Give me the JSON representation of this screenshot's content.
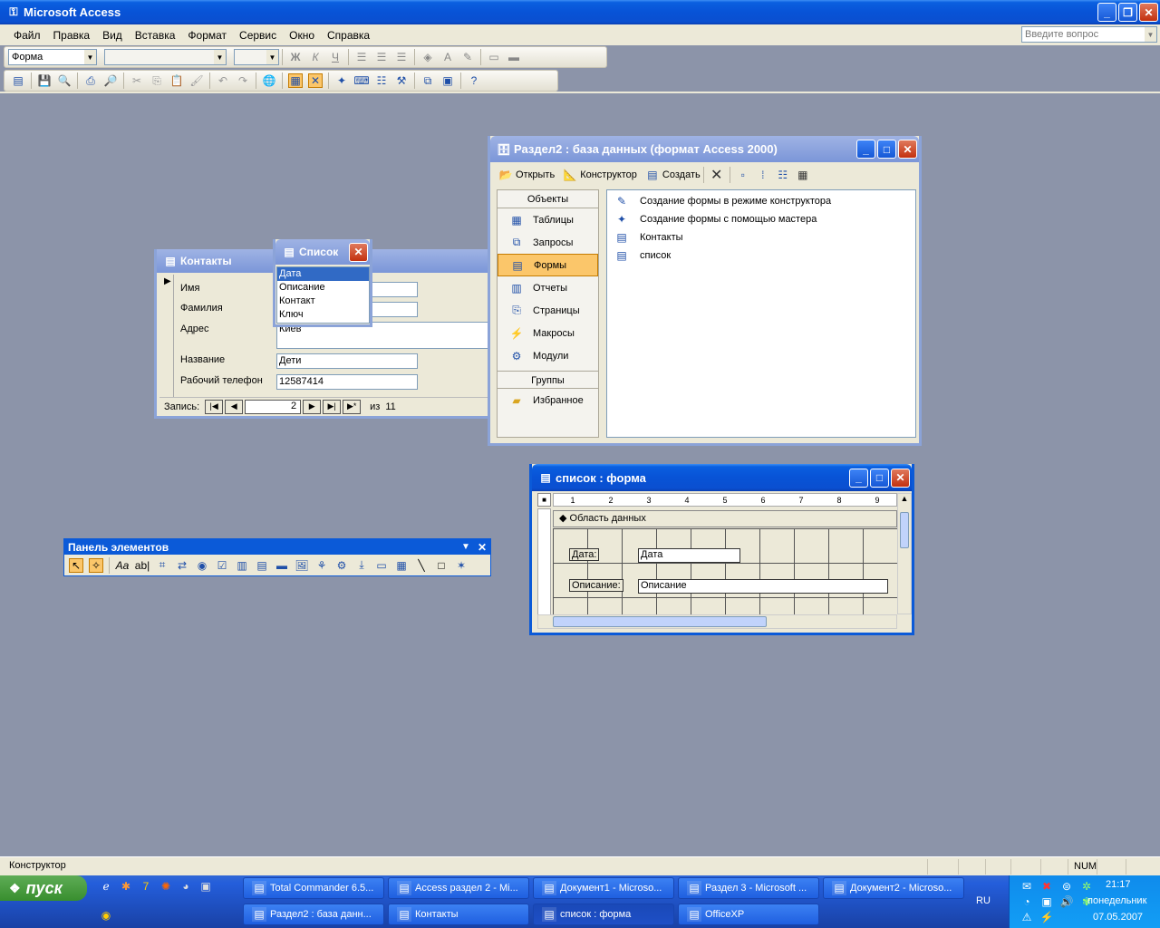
{
  "app": {
    "title": "Microsoft Access"
  },
  "menu": {
    "items": [
      "Файл",
      "Правка",
      "Вид",
      "Вставка",
      "Формат",
      "Сервис",
      "Окно",
      "Справка"
    ],
    "help_placeholder": "Введите вопрос"
  },
  "format_toolbar": {
    "object_value": "Форма"
  },
  "contacts_form": {
    "title": "Контакты",
    "fields": [
      {
        "label": "Имя",
        "value": ""
      },
      {
        "label": "Фамилия",
        "value": ""
      },
      {
        "label": "Адрес",
        "value": "Киев"
      },
      {
        "label": "Название",
        "value": "Дети"
      },
      {
        "label": "Рабочий телефон",
        "value": "12587414"
      }
    ],
    "nav": {
      "label": "Запись:",
      "current": "2",
      "of_label": "из",
      "total": "11"
    }
  },
  "list_popup": {
    "title": "Список",
    "items": [
      "Дата",
      "Описание",
      "Контакт",
      "Ключ"
    ],
    "selected": 0
  },
  "db_window": {
    "title": "Раздел2 : база данных (формат Access 2000)",
    "toolbar": {
      "open": "Открыть",
      "design": "Конструктор",
      "create": "Создать"
    },
    "objects_header": "Объекты",
    "objects": [
      {
        "label": "Таблицы",
        "icon": "table-icon"
      },
      {
        "label": "Запросы",
        "icon": "query-icon"
      },
      {
        "label": "Формы",
        "icon": "form-icon",
        "selected": true
      },
      {
        "label": "Отчеты",
        "icon": "report-icon"
      },
      {
        "label": "Страницы",
        "icon": "page-icon"
      },
      {
        "label": "Макросы",
        "icon": "macro-icon"
      },
      {
        "label": "Модули",
        "icon": "module-icon"
      }
    ],
    "groups_header": "Группы",
    "groups": [
      {
        "label": "Избранное",
        "icon": "folder-icon"
      }
    ],
    "list": [
      {
        "label": "Создание формы в режиме конструктора",
        "icon": "design-wizard-icon"
      },
      {
        "label": "Создание формы с помощью мастера",
        "icon": "wizard-icon"
      },
      {
        "label": "Контакты",
        "icon": "form-icon"
      },
      {
        "label": "список",
        "icon": "form-icon"
      }
    ]
  },
  "design_window": {
    "title": "список : форма",
    "section": "Область данных",
    "ruler": [
      "1",
      "2",
      "3",
      "4",
      "5",
      "6",
      "7",
      "8",
      "9"
    ],
    "controls": [
      {
        "label": "Дата:",
        "field": "Дата"
      },
      {
        "label": "Описание:",
        "field": "Описание"
      }
    ]
  },
  "toolbox": {
    "title": "Панель элементов"
  },
  "status": {
    "text": "Конструктор",
    "num": "NUM"
  },
  "taskbar": {
    "start": "пуск",
    "row1": [
      "Total Commander 6.5...",
      "Access раздел 2 - Mi...",
      "Документ1 - Microso...",
      "Раздел 3 - Microsoft ...",
      "Документ2 - Microso..."
    ],
    "row2": [
      "Раздел2 : база данн...",
      "Контакты",
      "список : форма",
      "OfficeXP"
    ],
    "lang": "RU",
    "time": "21:17",
    "day": "понедельник",
    "date": "07.05.2007"
  }
}
